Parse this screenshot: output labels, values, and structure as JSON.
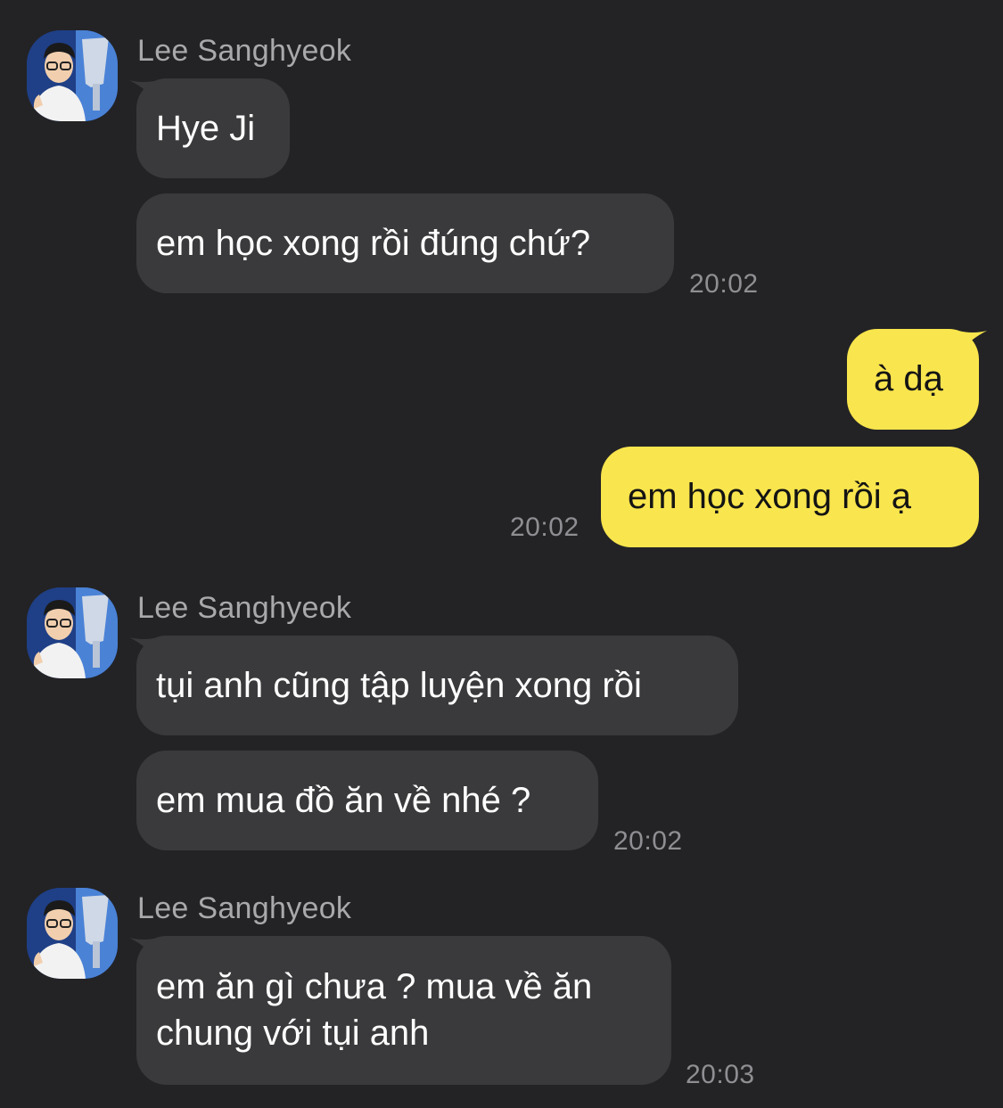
{
  "chat": {
    "groups": [
      {
        "sender": "Lee Sanghyeok",
        "messages": [
          "Hye Ji",
          "em học xong rồi đúng chứ?"
        ],
        "time": "20:02"
      },
      {
        "messages": [
          "à dạ",
          "em học xong rồi ạ"
        ],
        "time": "20:02"
      },
      {
        "sender": "Lee Sanghyeok",
        "messages": [
          "tụi anh cũng tập luyện xong rồi",
          "em mua đồ ăn về nhé ?"
        ],
        "time": "20:02"
      },
      {
        "sender": "Lee Sanghyeok",
        "messages": [
          "em ăn gì chưa ? mua về ăn chung với tụi anh"
        ],
        "time": "20:03"
      }
    ]
  },
  "colors": {
    "background": "#232325",
    "incoming_bubble": "#3a3a3c",
    "outgoing_bubble": "#f9e54d",
    "sender_name": "#a9a9ab",
    "timestamp": "#8f8f93"
  },
  "icons": {
    "avatar": "profile-photo"
  }
}
